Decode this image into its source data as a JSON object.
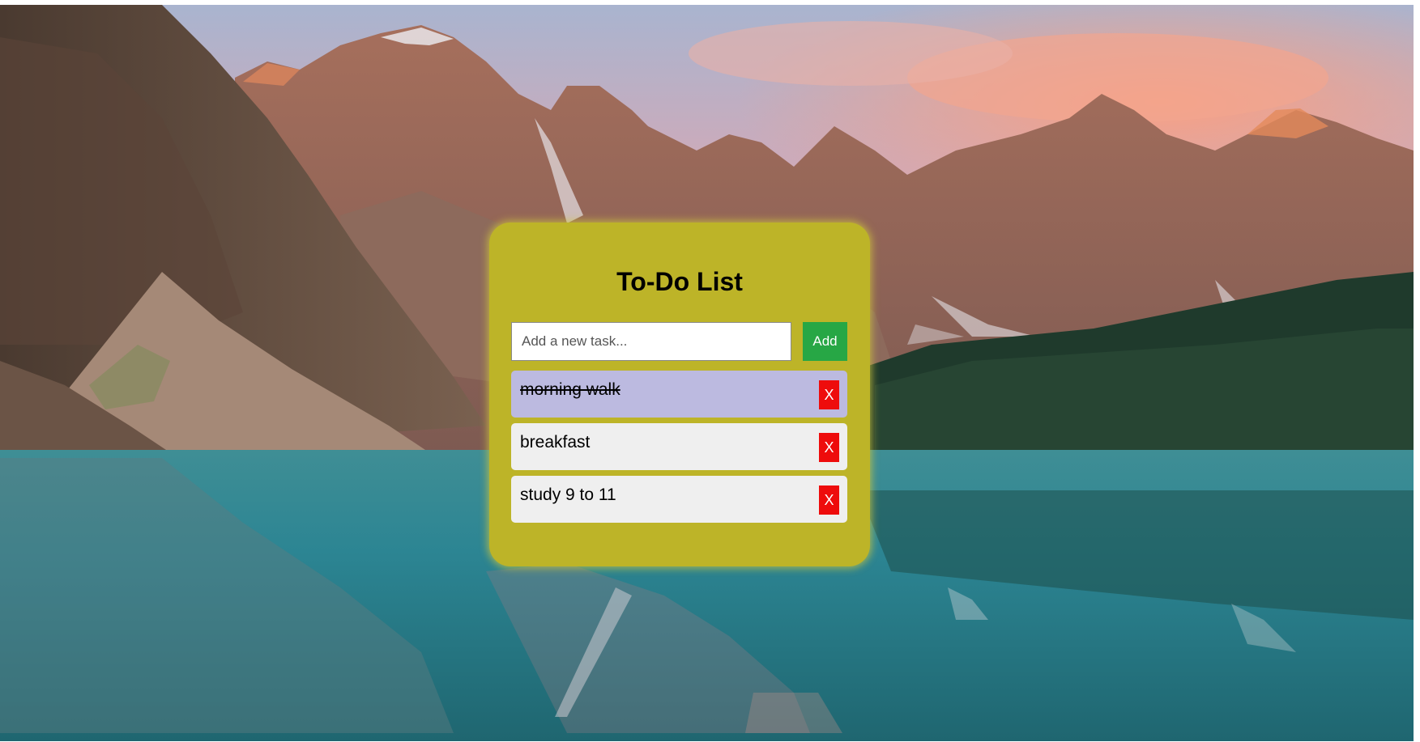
{
  "app": {
    "title": "To-Do List"
  },
  "form": {
    "input_value": "",
    "input_placeholder": "Add a new task...",
    "add_label": "Add"
  },
  "tasks": [
    {
      "text": "morning walk",
      "completed": true,
      "delete_label": "X"
    },
    {
      "text": "breakfast",
      "completed": false,
      "delete_label": "X"
    },
    {
      "text": "study 9 to 11",
      "completed": false,
      "delete_label": "X"
    }
  ],
  "colors": {
    "card_background": "#bdb428",
    "add_button": "#27a745",
    "delete_button": "#ee0c0c",
    "task_background": "#efefef",
    "completed_task_background": "#bcbae0"
  },
  "background": {
    "image": "mountain lake landscape with pink sunset sky, rocky peaks, pine forest and turquoise water reflection"
  }
}
